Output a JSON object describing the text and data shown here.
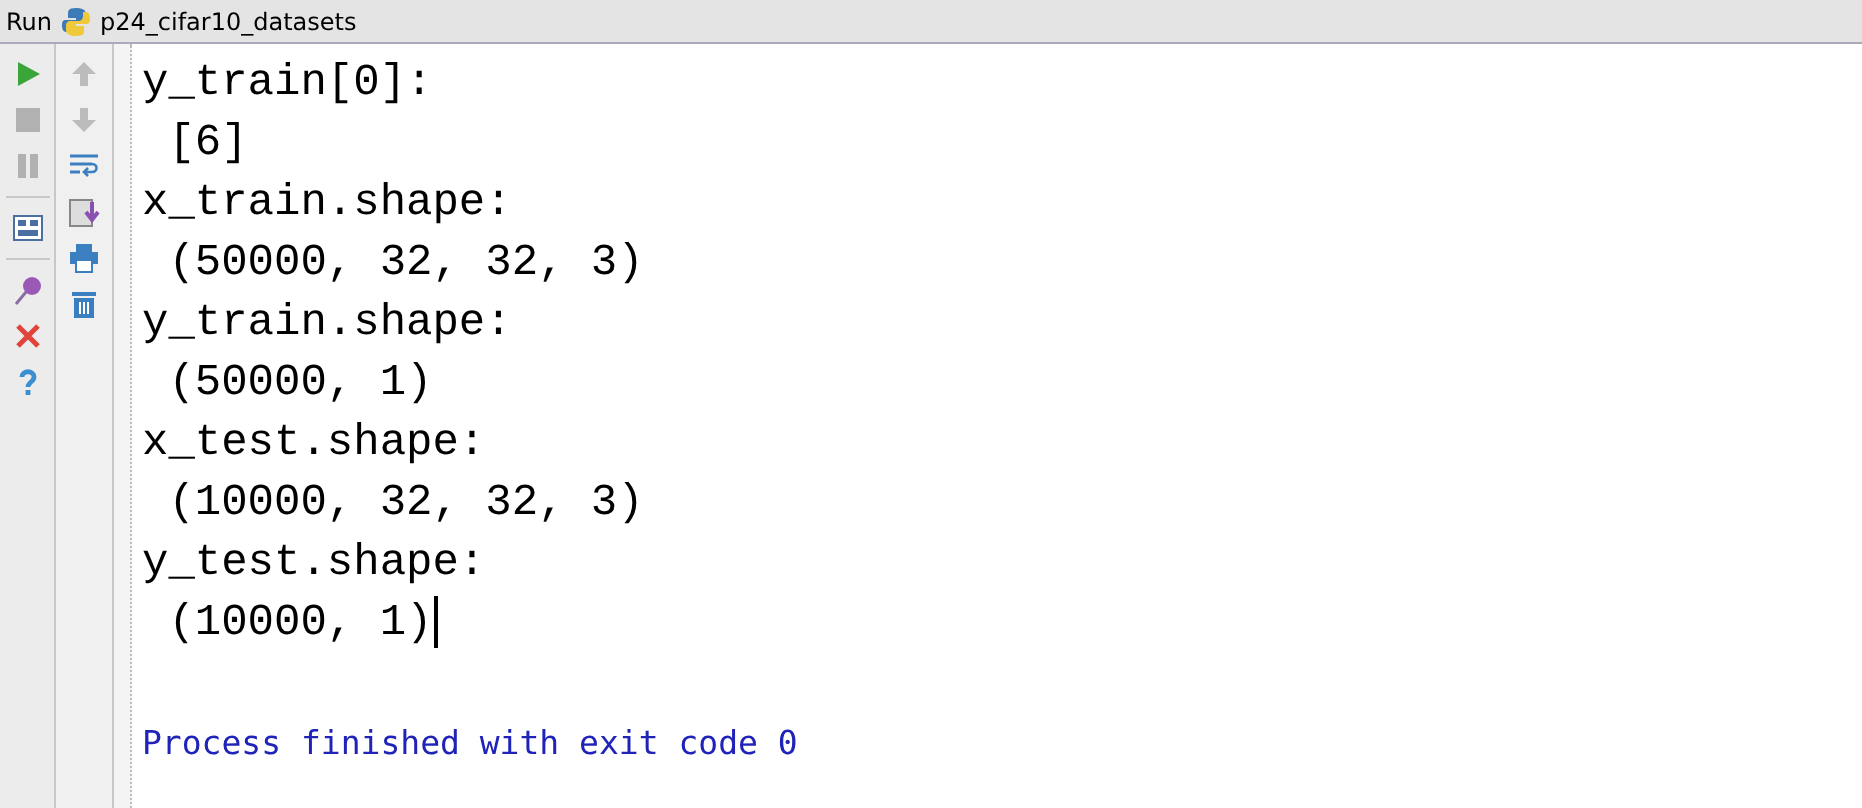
{
  "title_bar": {
    "label": "Run",
    "config": "p24_cifar10_datasets"
  },
  "toolbar_main": [
    {
      "kind": "run",
      "disabled": false
    },
    {
      "kind": "stop",
      "disabled": true
    },
    {
      "kind": "pause",
      "disabled": true
    },
    {
      "kind": "sep"
    },
    {
      "kind": "layout",
      "disabled": false
    },
    {
      "kind": "sep"
    },
    {
      "kind": "pin",
      "disabled": false
    },
    {
      "kind": "close",
      "disabled": false
    },
    {
      "kind": "help",
      "disabled": false
    }
  ],
  "toolbar_side": [
    {
      "kind": "up",
      "disabled": true
    },
    {
      "kind": "down",
      "disabled": true
    },
    {
      "kind": "wrap",
      "disabled": false
    },
    {
      "kind": "scroll",
      "disabled": false
    },
    {
      "kind": "print",
      "disabled": false
    },
    {
      "kind": "trash",
      "disabled": false
    }
  ],
  "console": [
    {
      "kind": "output",
      "text": "y_train[0]:",
      "caret": false
    },
    {
      "kind": "output",
      "text": " [6]",
      "caret": false
    },
    {
      "kind": "output",
      "text": "x_train.shape:",
      "caret": false
    },
    {
      "kind": "output",
      "text": " (50000, 32, 32, 3)",
      "caret": false
    },
    {
      "kind": "output",
      "text": "y_train.shape:",
      "caret": false
    },
    {
      "kind": "output",
      "text": " (50000, 1)",
      "caret": false
    },
    {
      "kind": "output",
      "text": "x_test.shape:",
      "caret": false
    },
    {
      "kind": "output",
      "text": " (10000, 32, 32, 3)",
      "caret": false
    },
    {
      "kind": "output",
      "text": "y_test.shape:",
      "caret": false
    },
    {
      "kind": "output",
      "text": " (10000, 1)",
      "caret": true
    },
    {
      "kind": "system",
      "text": "Process finished with exit code 0",
      "caret": false
    }
  ]
}
